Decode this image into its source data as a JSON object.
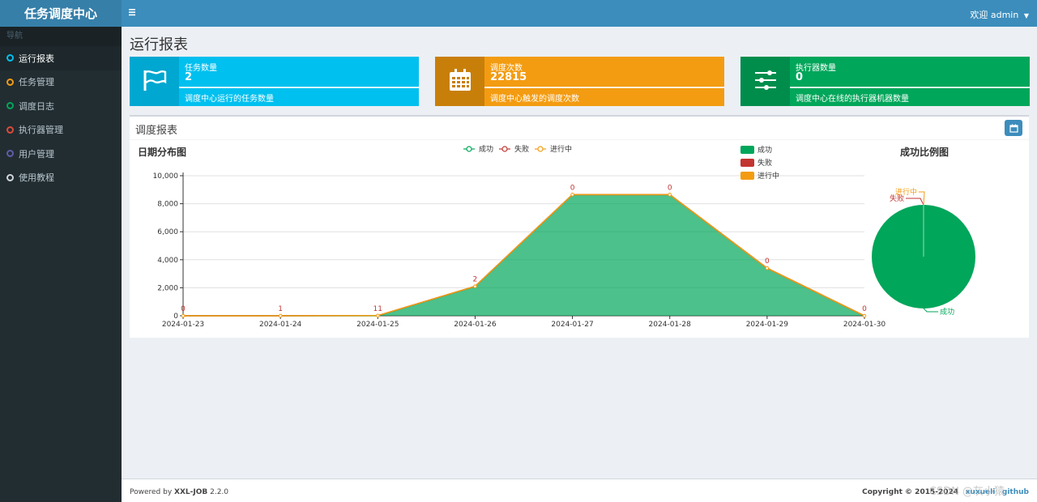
{
  "app": {
    "title": "任务调度中心"
  },
  "nav": {
    "header": "导航",
    "items": [
      {
        "label": "运行报表",
        "color": "#00c0ef",
        "active": true
      },
      {
        "label": "任务管理",
        "color": "#f39c12"
      },
      {
        "label": "调度日志",
        "color": "#00a65a"
      },
      {
        "label": "执行器管理",
        "color": "#dd4b39"
      },
      {
        "label": "用户管理",
        "color": "#605ca8"
      },
      {
        "label": "使用教程",
        "color": "#d2d6de"
      }
    ]
  },
  "header": {
    "user_label": "欢迎 admin"
  },
  "page": {
    "title": "运行报表"
  },
  "infoboxes": [
    {
      "label": "任务数量",
      "value": "2",
      "desc": "调度中心运行的任务数量",
      "icon": "flag-icon",
      "color": "#00c0ef",
      "icon_bg": "#00a7d0"
    },
    {
      "label": "调度次数",
      "value": "22815",
      "desc": "调度中心触发的调度次数",
      "icon": "calendar-icon",
      "color": "#f39c12",
      "icon_bg": "#c87f0a"
    },
    {
      "label": "执行器数量",
      "value": "0",
      "desc": "调度中心在线的执行器机器数量",
      "icon": "sliders-icon",
      "color": "#00a65a",
      "icon_bg": "#008d4c"
    }
  ],
  "report": {
    "title": "调度报表",
    "line_title": "日期分布图",
    "pie_title": "成功比例图"
  },
  "chart_data": [
    {
      "type": "area",
      "title": "日期分布图",
      "x": [
        "2024-01-23",
        "2024-01-24",
        "2024-01-25",
        "2024-01-26",
        "2024-01-27",
        "2024-01-28",
        "2024-01-29",
        "2024-01-30"
      ],
      "series": [
        {
          "name": "成功",
          "color": "#00a65a",
          "values": [
            0,
            0,
            0,
            2100,
            8650,
            8650,
            3400,
            0
          ]
        },
        {
          "name": "失败",
          "color": "#c23531",
          "values": [
            0,
            1,
            11,
            2,
            0,
            0,
            0,
            0
          ]
        },
        {
          "name": "进行中",
          "color": "#f39c12",
          "values": [
            0,
            0,
            0,
            0,
            0,
            0,
            0,
            0
          ]
        }
      ],
      "ylim": [
        0,
        10000
      ],
      "yticks": [
        "0",
        "2,000",
        "4,000",
        "6,000",
        "8,000",
        "10,000"
      ],
      "data_labels": [
        "0",
        "1",
        "11",
        "2",
        "0",
        "0",
        "0",
        "0"
      ],
      "legend": [
        "成功",
        "失败",
        "进行中"
      ],
      "grid": true
    },
    {
      "type": "pie",
      "title": "成功比例图",
      "slices": [
        {
          "name": "成功",
          "value": 22801,
          "color": "#00a65a"
        },
        {
          "name": "失败",
          "value": 14,
          "color": "#c23531"
        },
        {
          "name": "进行中",
          "value": 0,
          "color": "#f39c12"
        }
      ],
      "legend": [
        "成功",
        "失败",
        "进行中"
      ]
    }
  ],
  "footer": {
    "powered": "Powered by ",
    "product": "XXL-JOB",
    "version": " 2.2.0",
    "copyright": "Copyright © 2015-2024",
    "link1": "xuxueli",
    "link2": "github"
  },
  "watermark": "CSDN @灰小猿"
}
